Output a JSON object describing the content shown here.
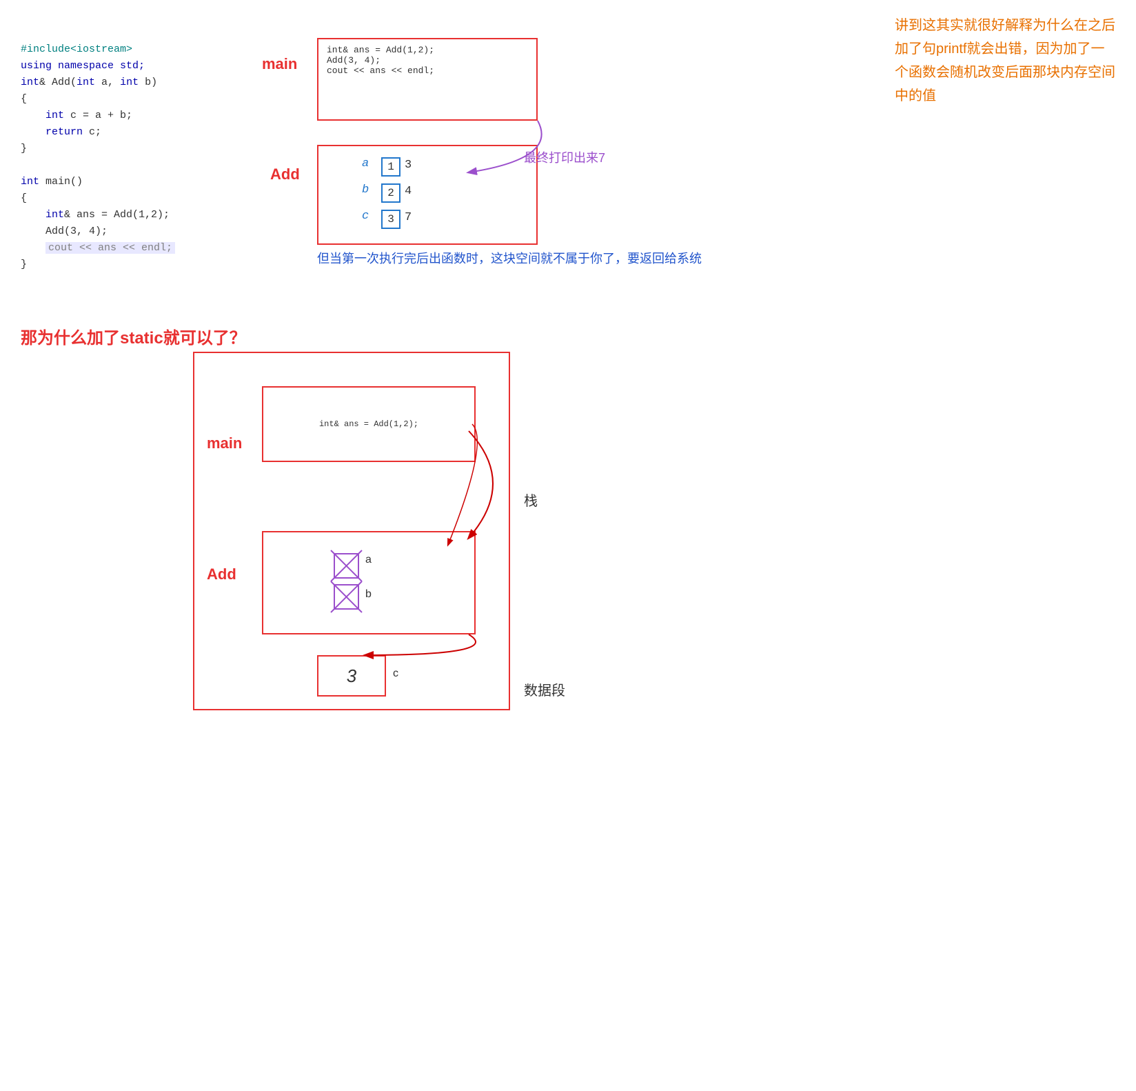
{
  "code": {
    "lines": [
      "#include<iostream>",
      "using namespace std;",
      "int& Add(int a, int b)",
      "{",
      "    int c = a + b;",
      "    return c;",
      "}",
      "",
      "int main()",
      "{",
      "    int& ans = Add(1,2);",
      "    Add(3, 4);",
      "    cout << ans << endl;",
      "}"
    ]
  },
  "explain_right": {
    "text": "讲到这其实就很好解释为什么在之后加了句printf就会出错，因为加了一个函数会随机改变后面那块内存空间中的值"
  },
  "diagram_top": {
    "main_label": "main",
    "add_label": "Add",
    "main_code": "int& ans = Add(1,2);\nAdd(3, 4);\ncout << ans << endl;",
    "final_print": "最终打印出来7"
  },
  "explain_bottom": {
    "text": "但当第一次执行完后出函数时，这块空间就不属于你了，要返回给系统"
  },
  "section_heading": "那为什么加了static就可以了？",
  "big_diagram": {
    "main_label": "main",
    "add_label": "Add",
    "stack_label": "栈",
    "data_segment_label": "数据段",
    "main_code": "int& ans = Add(1,2);",
    "data_value": "3"
  },
  "labels": {
    "a": "a",
    "b": "b",
    "c": "c"
  }
}
